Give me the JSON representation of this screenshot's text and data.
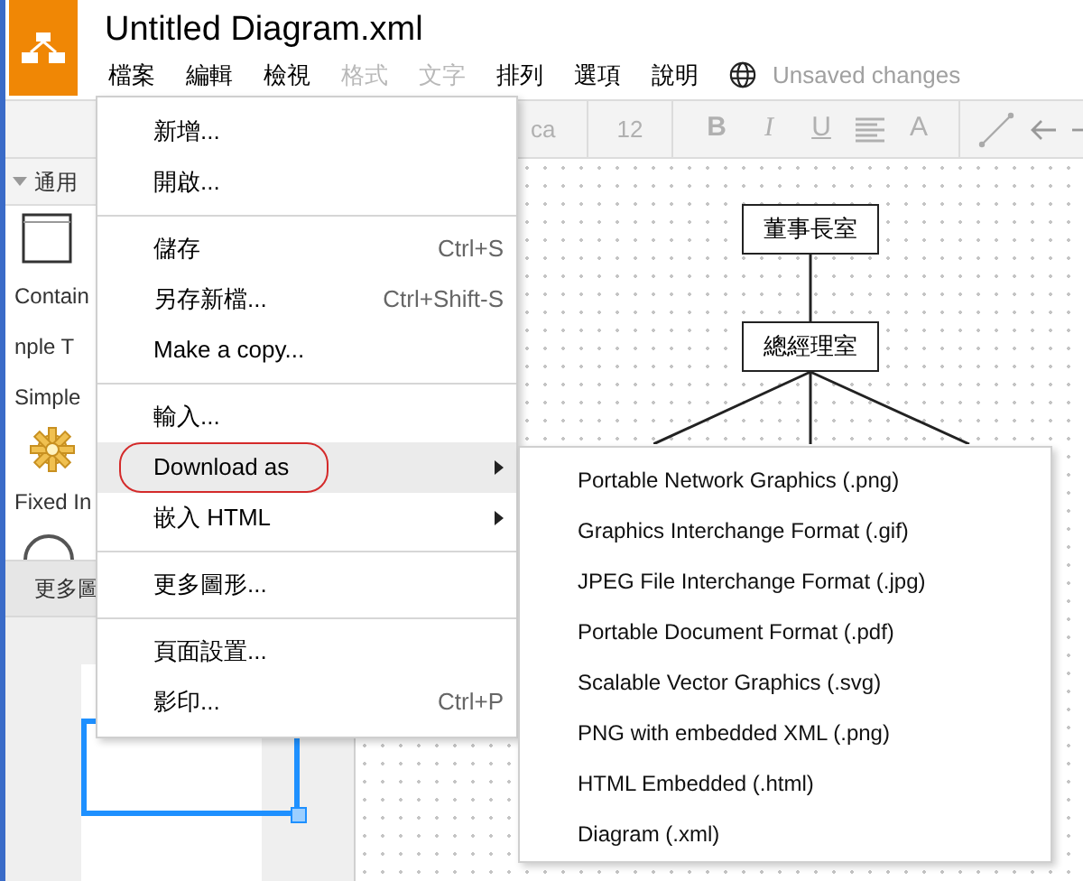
{
  "app": {
    "title": "Untitled Diagram.xml",
    "status": "Unsaved changes"
  },
  "menubar": [
    {
      "label": "檔案",
      "disabled": false
    },
    {
      "label": "編輯",
      "disabled": false
    },
    {
      "label": "檢視",
      "disabled": false
    },
    {
      "label": "格式",
      "disabled": true
    },
    {
      "label": "文字",
      "disabled": true
    },
    {
      "label": "排列",
      "disabled": false
    },
    {
      "label": "選項",
      "disabled": false
    },
    {
      "label": "說明",
      "disabled": false
    }
  ],
  "toolbar": {
    "font": "ca",
    "size": "12",
    "format_buttons": [
      {
        "label": "B",
        "kind": "bold"
      },
      {
        "label": "I",
        "kind": "italic"
      },
      {
        "label": "U",
        "kind": "underline"
      },
      {
        "kind": "align"
      },
      {
        "label": "A",
        "kind": "plain"
      }
    ]
  },
  "sidebar": {
    "section": "通用",
    "items": [
      {
        "kind": "container",
        "label": "Contain"
      },
      {
        "kind": "none",
        "label": "nple T"
      },
      {
        "kind": "none",
        "label": "Simple"
      },
      {
        "kind": "gear",
        "label": "Fixed In"
      },
      {
        "kind": "arc"
      }
    ],
    "more": "更多圖"
  },
  "diagram": {
    "nodes": [
      "董事長室",
      "總經理室"
    ]
  },
  "file_menu": {
    "groups": [
      [
        {
          "label": "新增...",
          "selected": false
        },
        {
          "label": "開啟...",
          "selected": false
        }
      ],
      [
        {
          "label": "儲存",
          "shortcut": "Ctrl+S",
          "selected": false
        },
        {
          "label": "另存新檔...",
          "shortcut": "Ctrl+Shift-S",
          "selected": false
        },
        {
          "label": "Make a copy...",
          "selected": false
        }
      ],
      [
        {
          "label": "輸入...",
          "selected": false
        },
        {
          "label": "Download as",
          "submenu": true,
          "circled": true,
          "selected": true
        },
        {
          "label": "嵌入 HTML",
          "submenu": true,
          "selected": false
        }
      ],
      [
        {
          "label": "更多圖形...",
          "selected": false
        }
      ],
      [
        {
          "label": "頁面設置...",
          "selected": false
        },
        {
          "label": "影印...",
          "shortcut": "Ctrl+P",
          "selected": false
        }
      ]
    ]
  },
  "download_menu": [
    "Portable Network Graphics (.png)",
    "Graphics Interchange Format (.gif)",
    "JPEG File Interchange Format (.jpg)",
    "Portable Document Format (.pdf)",
    "Scalable Vector Graphics (.svg)",
    "PNG with embedded XML (.png)",
    "HTML Embedded (.html)",
    "Diagram (.xml)"
  ]
}
